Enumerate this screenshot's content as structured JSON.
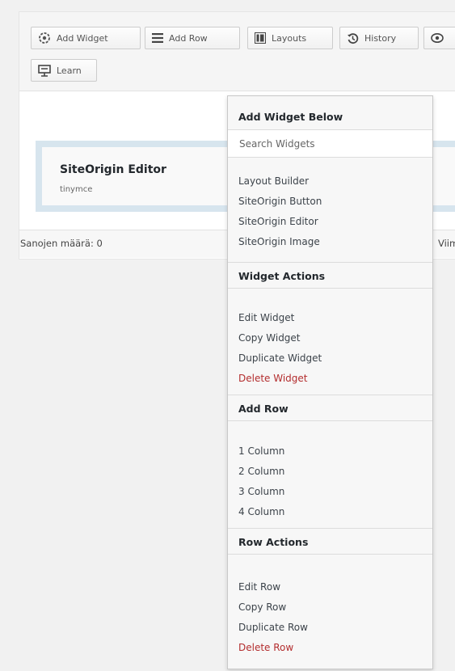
{
  "toolbar": {
    "add_widget": "Add Widget",
    "add_row": "Add Row",
    "layouts": "Layouts",
    "history": "History",
    "learn": "Learn"
  },
  "widget": {
    "title": "SiteOrigin Editor",
    "description": "tinymce"
  },
  "status": {
    "word_count": "Sanojen määrä: 0",
    "right_text": "Viime"
  },
  "context_menu": {
    "add_widget_below": {
      "title": "Add Widget Below",
      "search_placeholder": "Search Widgets",
      "items": [
        "Layout Builder",
        "SiteOrigin Button",
        "SiteOrigin Editor",
        "SiteOrigin Image"
      ]
    },
    "widget_actions": {
      "title": "Widget Actions",
      "items": [
        "Edit Widget",
        "Copy Widget",
        "Duplicate Widget",
        "Delete Widget"
      ]
    },
    "add_row": {
      "title": "Add Row",
      "items": [
        "1 Column",
        "2 Column",
        "3 Column",
        "4 Column"
      ]
    },
    "row_actions": {
      "title": "Row Actions",
      "items": [
        "Edit Row",
        "Copy Row",
        "Duplicate Row",
        "Delete Row"
      ]
    }
  },
  "colors": {
    "danger": "#b32d2e",
    "row_background": "#d7e5ee"
  },
  "icons": [
    "add-widget-icon",
    "add-row-icon",
    "layouts-icon",
    "history-icon",
    "eye-icon",
    "learn-icon"
  ]
}
